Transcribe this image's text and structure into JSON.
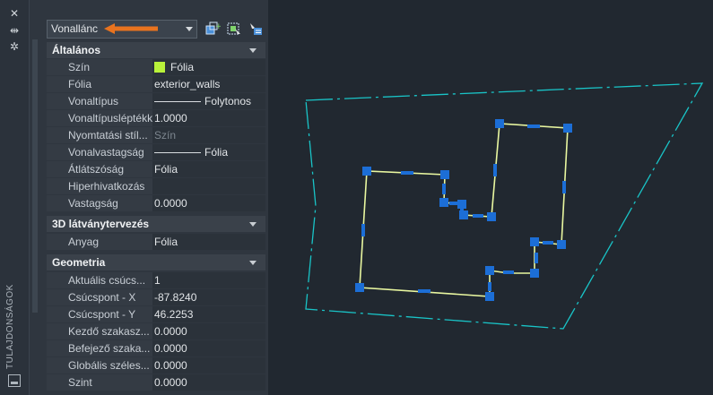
{
  "window": {
    "vertical_title": "TULAJDONSÁGOK"
  },
  "icons": {
    "close": "close-icon",
    "pin": "pin-icon",
    "settings": "settings-icon",
    "panel": "panel-icon"
  },
  "selector": {
    "value": "Vonallánc"
  },
  "toolbar": {
    "buttons": [
      "toggle-pickadd-icon",
      "select-objects-icon",
      "quick-select-icon"
    ]
  },
  "colors": {
    "accent": "#e8731f",
    "polyline": "#e9f7a0",
    "grip": "#1c6ed6",
    "boundary": "#19c4c7"
  },
  "sections": {
    "general": {
      "title": "Általános",
      "rows": [
        {
          "label": "Szín",
          "value": "Fólia"
        },
        {
          "label": "Fólia",
          "value": "exterior_walls"
        },
        {
          "label": "Vonaltípus",
          "value": "Folytonos"
        },
        {
          "label": "Vonaltípusléptékk",
          "value": "1.0000"
        },
        {
          "label": "Nyomtatási stíl...",
          "value": "Szín"
        },
        {
          "label": "Vonalvastagság",
          "value": "Fólia"
        },
        {
          "label": "Átlátszóság",
          "value": "Fólia"
        },
        {
          "label": "Hiperhivatkozás",
          "value": ""
        },
        {
          "label": "Vastagság",
          "value": "0.0000"
        }
      ]
    },
    "visual3d": {
      "title": "3D látványtervezés",
      "rows": [
        {
          "label": "Anyag",
          "value": "Fólia"
        }
      ]
    },
    "geometry": {
      "title": "Geometria",
      "rows": [
        {
          "label": "Aktuális csúcs...",
          "value": "1"
        },
        {
          "label": "Csúcspont - X",
          "value": "-87.8240"
        },
        {
          "label": "Csúcspont - Y",
          "value": "46.2253"
        },
        {
          "label": "Kezdő szakasz...",
          "value": "0.0000"
        },
        {
          "label": "Befejező szaka...",
          "value": "0.0000"
        },
        {
          "label": "Globális széles...",
          "value": "0.0000"
        },
        {
          "label": "Szint",
          "value": "0.0000"
        }
      ]
    }
  }
}
